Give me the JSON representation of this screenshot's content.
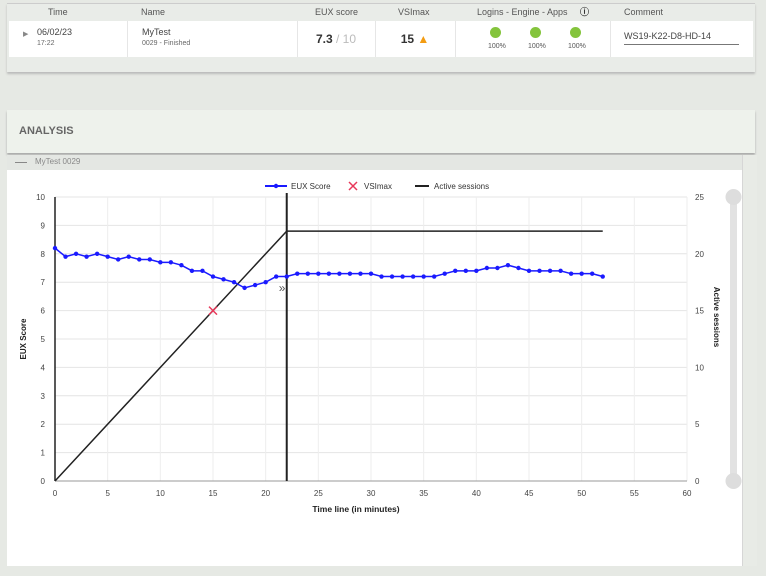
{
  "table": {
    "headers": {
      "time": "Time",
      "name": "Name",
      "eux": "EUX score",
      "vsimax": "VSImax",
      "lea": "Logins - Engine - Apps",
      "comment": "Comment"
    },
    "row": {
      "date": "06/02/23",
      "time": "17:22",
      "name": "MyTest",
      "sub": "0029 - Finished",
      "eux": "7.3",
      "eux_max": "/ 10",
      "vsimax": "15",
      "logins_pct": "100%",
      "engine_pct": "100%",
      "apps_pct": "100%",
      "comment": "WS19-K22-D8-HD-14"
    }
  },
  "analysis": {
    "title": "ANALYSIS",
    "series_label": "MyTest 0029"
  },
  "colors": {
    "eux": "#1a1aff",
    "vsimax": "#e8385a",
    "sessions": "#222222",
    "status_ok": "#84c43c",
    "warning": "#f39c12"
  },
  "chart_data": {
    "type": "line",
    "xlabel": "Time line (in minutes)",
    "ylabel": "EUX Score",
    "y2label": "Active sessions",
    "xlim": [
      0,
      60
    ],
    "ylim": [
      0,
      10
    ],
    "y2lim": [
      0,
      25
    ],
    "xticks": [
      "0",
      "5",
      "10",
      "15",
      "20",
      "25",
      "30",
      "35",
      "40",
      "45",
      "50",
      "55",
      "60"
    ],
    "yticks": [
      "0",
      "1",
      "2",
      "3",
      "4",
      "5",
      "6",
      "7",
      "8",
      "9",
      "10"
    ],
    "y2ticks": [
      "0",
      "5",
      "10",
      "15",
      "20",
      "25"
    ],
    "legend": [
      "EUX Score",
      "VSImax",
      "Active sessions"
    ],
    "eux": [
      8.2,
      7.9,
      8.0,
      7.9,
      8.0,
      7.9,
      7.8,
      7.9,
      7.8,
      7.8,
      7.7,
      7.7,
      7.6,
      7.4,
      7.4,
      7.2,
      7.1,
      7.0,
      6.8,
      6.9,
      7.0,
      7.2,
      7.2,
      7.3,
      7.3,
      7.3,
      7.3,
      7.3,
      7.3,
      7.3,
      7.3,
      7.2,
      7.2,
      7.2,
      7.2,
      7.2,
      7.2,
      7.3,
      7.4,
      7.4,
      7.4,
      7.5,
      7.5,
      7.6,
      7.5,
      7.4,
      7.4,
      7.4,
      7.4,
      7.3,
      7.3,
      7.3,
      7.2
    ],
    "vsimax": {
      "x": 15,
      "y": 6
    },
    "sessions": [
      [
        0,
        0
      ],
      [
        22,
        22
      ],
      [
        52,
        22
      ]
    ],
    "vline_x": 22
  }
}
